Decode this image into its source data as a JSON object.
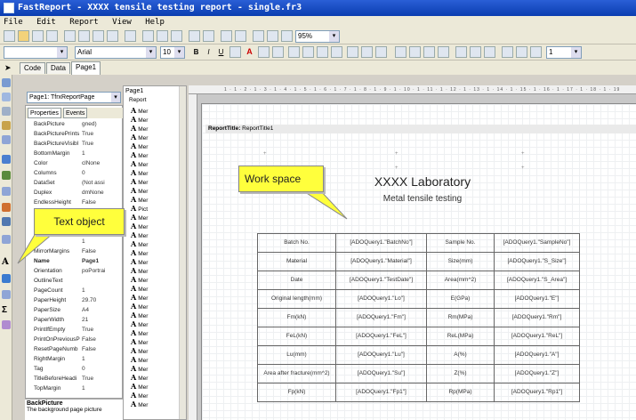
{
  "window": {
    "title": "FastReport - XXXX tensile testing report - single.fr3"
  },
  "menu": [
    "File",
    "Edit",
    "Report",
    "View",
    "Help"
  ],
  "toolbar": {
    "zoom": "95%",
    "font_name": "Arial",
    "font_size": "10",
    "frame_width": "1"
  },
  "tabs": [
    "Code",
    "Data",
    "Page1"
  ],
  "inspector": {
    "selected_object": "Page1: TfrxReportPage",
    "tabs": [
      "Properties",
      "Events"
    ],
    "properties": [
      {
        "key": "BackPicture",
        "value": "gned)"
      },
      {
        "key": "BackPicturePrints",
        "value": "True"
      },
      {
        "key": "BackPictureVisibl",
        "value": "True"
      },
      {
        "key": "BottomMargin",
        "value": "1"
      },
      {
        "key": "Color",
        "value": "clNone"
      },
      {
        "key": "Columns",
        "value": "0"
      },
      {
        "key": "DataSet",
        "value": "(Not assi"
      },
      {
        "key": "Duplex",
        "value": "dmNone"
      },
      {
        "key": "EndlessHeight",
        "value": "False"
      },
      {
        "key": "",
        "value": ""
      },
      {
        "key": "",
        "value": ""
      },
      {
        "key": "",
        "value": ""
      },
      {
        "key": "Lef",
        "value": "1"
      },
      {
        "key": "MirrorMargins",
        "value": "False"
      },
      {
        "key": "Name",
        "value": "Page1"
      },
      {
        "key": "Orientation",
        "value": "poPortrai"
      },
      {
        "key": "OutlineText",
        "value": ""
      },
      {
        "key": "PageCount",
        "value": "1"
      },
      {
        "key": "PaperHeight",
        "value": "29.70"
      },
      {
        "key": "PaperSize",
        "value": "A4"
      },
      {
        "key": "PaperWidth",
        "value": "21"
      },
      {
        "key": "PrintIfEmpty",
        "value": "True"
      },
      {
        "key": "PrintOnPreviousP",
        "value": "False"
      },
      {
        "key": "ResetPageNumb",
        "value": "False"
      },
      {
        "key": "RightMargin",
        "value": "1"
      },
      {
        "key": "Tag",
        "value": "0"
      },
      {
        "key": "TitleBeforeHeadi",
        "value": "True"
      },
      {
        "key": "TopMargin",
        "value": "1"
      }
    ],
    "desc_title": "BackPicture",
    "desc_text": "The background page picture"
  },
  "tree": {
    "header": "Page1",
    "report": "Report",
    "items": [
      "Mer",
      "Mer",
      "Mer",
      "Mer",
      "Mer",
      "Mer",
      "Mer",
      "Mer",
      "Mer",
      "Mer",
      "Mer",
      "Pict",
      "Mer",
      "Mer",
      "Mer",
      "Mer",
      "Mer",
      "Mer",
      "Mer",
      "Mer",
      "Mer",
      "Mer",
      "Mer",
      "Mer",
      "Mer",
      "Mer",
      "Mer",
      "Mer",
      "Mer",
      "Mer",
      "Mer",
      "Mer",
      "Mer",
      "Mer"
    ]
  },
  "ruler": "1 · 1 · 2 · 1 · 3 · 1 · 4 · 1 · 5 · 1 · 6 · 1 · 7 · 1 · 8 · 1 · 9 · 1 · 10 · 1 · 11 · 1 · 12 · 1 · 13 · 1 · 14 · 1 · 15 · 1 · 16 · 1 · 17 · 1 · 18 · 1 · 19",
  "band": {
    "type": "ReportTitle:",
    "name": "ReportTitle1"
  },
  "report": {
    "title": "XXXX Laboratory",
    "subtitle": "Metal tensile testing",
    "rows": [
      [
        "Batch No.",
        "[ADOQuery1.\"BatchNo\"]",
        "Sample No.",
        "[ADOQuery1.\"SampleNo\"]"
      ],
      [
        "Material",
        "[ADOQuery1.\"Material\"]",
        "Size(mm)",
        "[ADOQuery1.\"S_Size\"]"
      ],
      [
        "Date",
        "[ADOQuery1.\"TestDate\"]",
        "Area(mm^2)",
        "[ADOQuery1.\"S_Area\"]"
      ],
      [
        "Original length(mm)",
        "[ADOQuery1.\"Lo\"]",
        "E(GPa)",
        "[ADOQuery1.\"E\"]"
      ],
      [
        "Fm(kN)",
        "[ADOQuery1.\"Fm\"]",
        "Rm(MPa)",
        "[ADOQuery1.\"Rm\"]"
      ],
      [
        "FeL(kN)",
        "[ADOQuery1.\"FeL\"]",
        "ReL(MPa)",
        "[ADOQuery1.\"ReL\"]"
      ],
      [
        "Lu(mm)",
        "[ADOQuery1.\"Lu\"]",
        "A(%)",
        "[ADOQuery1.\"A\"]"
      ],
      [
        "Area after fracture(mm^2)",
        "[ADOQuery1.\"Su\"]",
        "Z(%)",
        "[ADOQuery1.\"Z\"]"
      ],
      [
        "Fp(kN)",
        "[ADOQuery1.\"Fp1\"]",
        "Rp(MPa)",
        "[ADOQuery1.\"Rp1\"]"
      ]
    ]
  },
  "callouts": {
    "work_space": "Work space",
    "text_object": "Text object"
  }
}
